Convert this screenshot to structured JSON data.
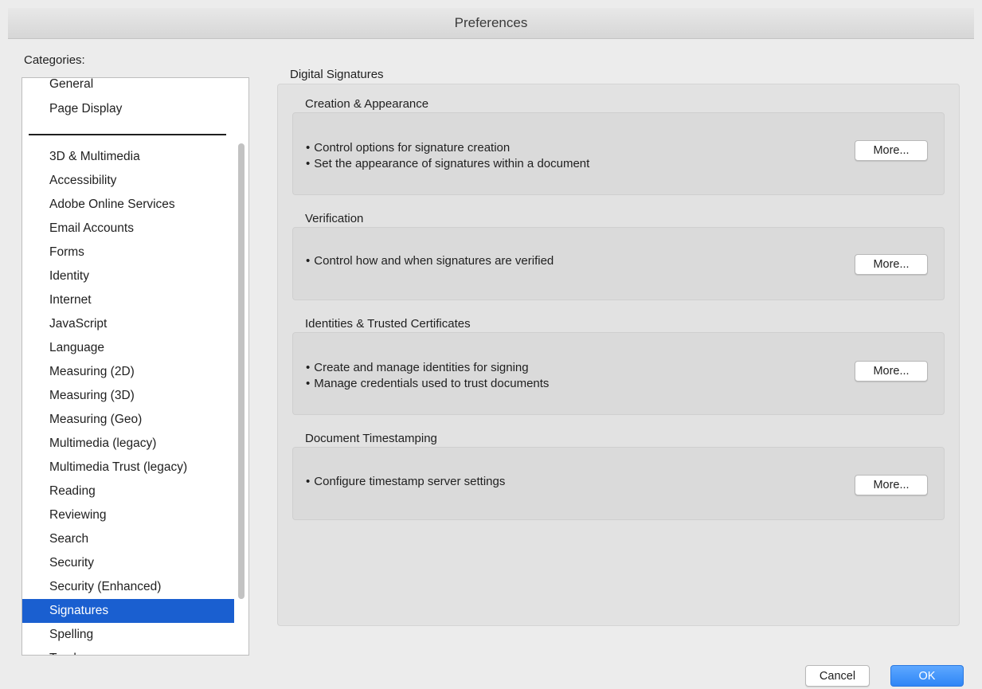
{
  "window": {
    "title": "Preferences"
  },
  "sidebar": {
    "label": "Categories:",
    "top_items": [
      "General",
      "Page Display"
    ],
    "items": [
      "3D & Multimedia",
      "Accessibility",
      "Adobe Online Services",
      "Email Accounts",
      "Forms",
      "Identity",
      "Internet",
      "JavaScript",
      "Language",
      "Measuring (2D)",
      "Measuring (3D)",
      "Measuring (Geo)",
      "Multimedia (legacy)",
      "Multimedia Trust (legacy)",
      "Reading",
      "Reviewing",
      "Search",
      "Security",
      "Security (Enhanced)",
      "Signatures",
      "Spelling",
      "Tracker"
    ],
    "selected": "Signatures"
  },
  "main": {
    "title": "Digital Signatures",
    "sections": [
      {
        "title": "Creation & Appearance",
        "bullets": [
          "Control options for signature creation",
          "Set the appearance of signatures within a document"
        ],
        "button": "More..."
      },
      {
        "title": "Verification",
        "bullets": [
          "Control how and when signatures are verified"
        ],
        "button": "More..."
      },
      {
        "title": "Identities & Trusted Certificates",
        "bullets": [
          "Create and manage identities for signing",
          "Manage credentials used to trust documents"
        ],
        "button": "More..."
      },
      {
        "title": "Document Timestamping",
        "bullets": [
          "Configure timestamp server settings"
        ],
        "button": "More..."
      }
    ]
  },
  "footer": {
    "cancel_label": "Cancel",
    "ok_label": "OK"
  },
  "colors": {
    "selection": "#1a5fd0",
    "ok_button": "#3a8ff8",
    "panel": "#e2e2e2"
  }
}
